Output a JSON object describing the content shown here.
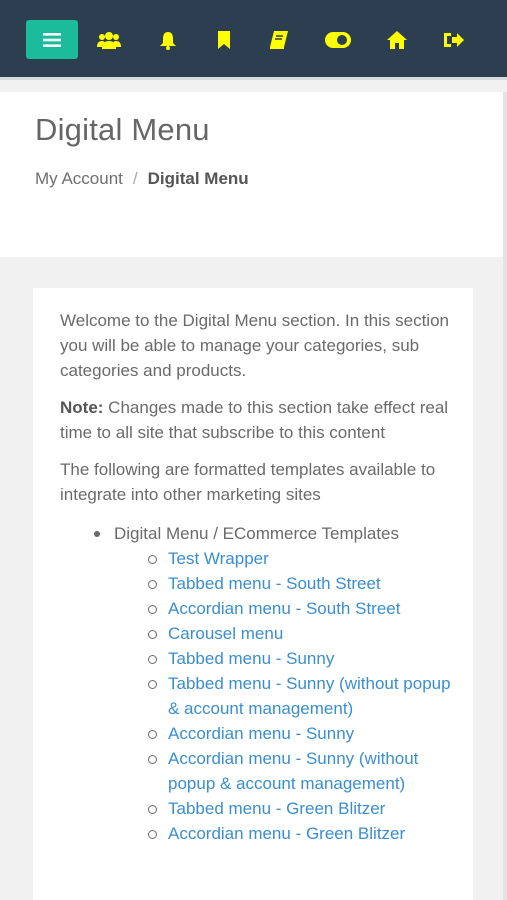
{
  "header": {
    "menu_icon": "hamburger-icon",
    "nav_icons": [
      "users-icon",
      "bell-icon",
      "bookmark-icon",
      "book-icon",
      "toggle-icon",
      "home-icon",
      "logout-icon"
    ],
    "icon_color": "#ffff00",
    "bar_color": "#2c3e50",
    "menu_button_color": "#1abc9c"
  },
  "page": {
    "title": "Digital Menu",
    "breadcrumb": {
      "parent": "My Account",
      "separator": "/",
      "current": "Digital Menu"
    }
  },
  "content": {
    "intro": "Welcome to the Digital Menu section. In this section you will be able to manage your categories, sub categories and products.",
    "note_label": "Note:",
    "note_text": " Changes made to this section take effect real time to all site that subscribe to this content",
    "templates_intro": "The following are formatted templates available to integrate into other marketing sites",
    "group_label": "Digital Menu / ECommerce Templates",
    "links": [
      "Test Wrapper",
      "Tabbed menu - South Street",
      "Accordian menu - South Street",
      "Carousel menu",
      "Tabbed menu - Sunny",
      "Tabbed menu - Sunny (without popup & account management)",
      "Accordian menu - Sunny",
      "Accordian menu - Sunny (without popup & account management)",
      "Tabbed menu - Green Blitzer",
      "Accordian menu - Green Blitzer"
    ],
    "link_color": "#3a8ed0"
  }
}
